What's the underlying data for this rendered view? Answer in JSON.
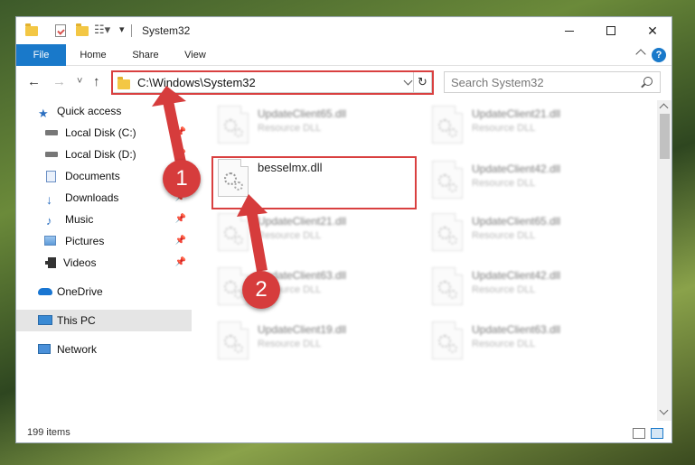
{
  "window": {
    "title": "System32",
    "controls": {
      "minimize": "—",
      "maximize": "☐",
      "close": "✕"
    }
  },
  "ribbon": {
    "tabs": [
      "File",
      "Home",
      "Share",
      "View"
    ],
    "help": "?"
  },
  "nav": {
    "back": "←",
    "forward": "→",
    "recent": "˅",
    "up": "↑",
    "address": "C:\\Windows\\System32",
    "refresh": "↻",
    "search_placeholder": "Search System32"
  },
  "sidebar": {
    "items": [
      {
        "label": "Quick access",
        "icon": "star-icon",
        "pinned": false
      },
      {
        "label": "Local Disk (C:)",
        "icon": "disk-icon",
        "pinned": true
      },
      {
        "label": "Local Disk (D:)",
        "icon": "disk-icon",
        "pinned": true
      },
      {
        "label": "Documents",
        "icon": "documents-icon",
        "pinned": true
      },
      {
        "label": "Downloads",
        "icon": "download-icon",
        "pinned": true
      },
      {
        "label": "Music",
        "icon": "music-icon",
        "pinned": true
      },
      {
        "label": "Pictures",
        "icon": "pictures-icon",
        "pinned": true
      },
      {
        "label": "Videos",
        "icon": "videos-icon",
        "pinned": true
      },
      {
        "label": "OneDrive",
        "icon": "cloud-icon",
        "pinned": false
      },
      {
        "label": "This PC",
        "icon": "pc-icon",
        "pinned": false,
        "selected": true
      },
      {
        "label": "Network",
        "icon": "network-icon",
        "pinned": false
      }
    ],
    "pin_glyph": "📌"
  },
  "files": {
    "highlighted": {
      "name": "besselmx.dll"
    },
    "left": [
      {
        "name": "UpdateClient65.dll",
        "type": "Resource DLL"
      },
      {
        "name": "UpdateClient21.dll",
        "type": "Resource DLL"
      },
      {
        "name": "UpdateClient63.dll",
        "type": "Resource DLL"
      },
      {
        "name": "UpdateClient19.dll",
        "type": "Resource DLL"
      }
    ],
    "right": [
      {
        "name": "UpdateClient21.dll",
        "type": "Resource DLL"
      },
      {
        "name": "UpdateClient42.dll",
        "type": "Resource DLL"
      },
      {
        "name": "UpdateClient65.dll",
        "type": "Resource DLL"
      },
      {
        "name": "UpdateClient42.dll",
        "type": "Resource DLL"
      },
      {
        "name": "UpdateClient63.dll",
        "type": "Resource DLL"
      }
    ]
  },
  "status": {
    "count": "199 items"
  },
  "callouts": [
    "1",
    "2"
  ],
  "colors": {
    "accent": "#1979ca",
    "callout": "#d63c3c",
    "highlight": "#d94040"
  }
}
